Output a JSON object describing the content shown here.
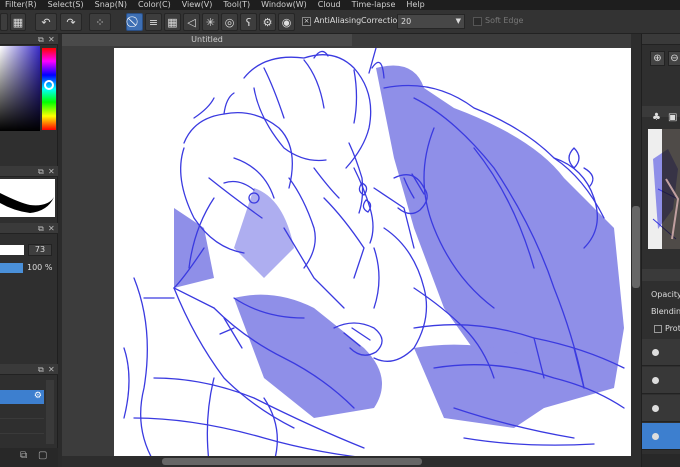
{
  "menu": [
    "Filter(R)",
    "Select(S)",
    "Snap(N)",
    "Color(C)",
    "View(V)",
    "Tool(T)",
    "Window(W)",
    "Cloud",
    "Time-lapse",
    "Help"
  ],
  "toolbar": {
    "antialiasing_label": "AntiAliasing",
    "correction_label": "Correction",
    "correction_value": "20",
    "soft_edge_label": "Soft Edge"
  },
  "canvas": {
    "tab_title": "Untitled"
  },
  "left_panel": {
    "brush_size": "73",
    "opacity_value": "100 %"
  },
  "right_panel": {
    "opacity_label": "Opacity",
    "blending_label": "Blending",
    "protect_label": "Prote"
  },
  "colors": {
    "accent": "#3d6fb4",
    "sketch": "#3a3ae0",
    "sketch_fill": "#8f8fe8"
  }
}
